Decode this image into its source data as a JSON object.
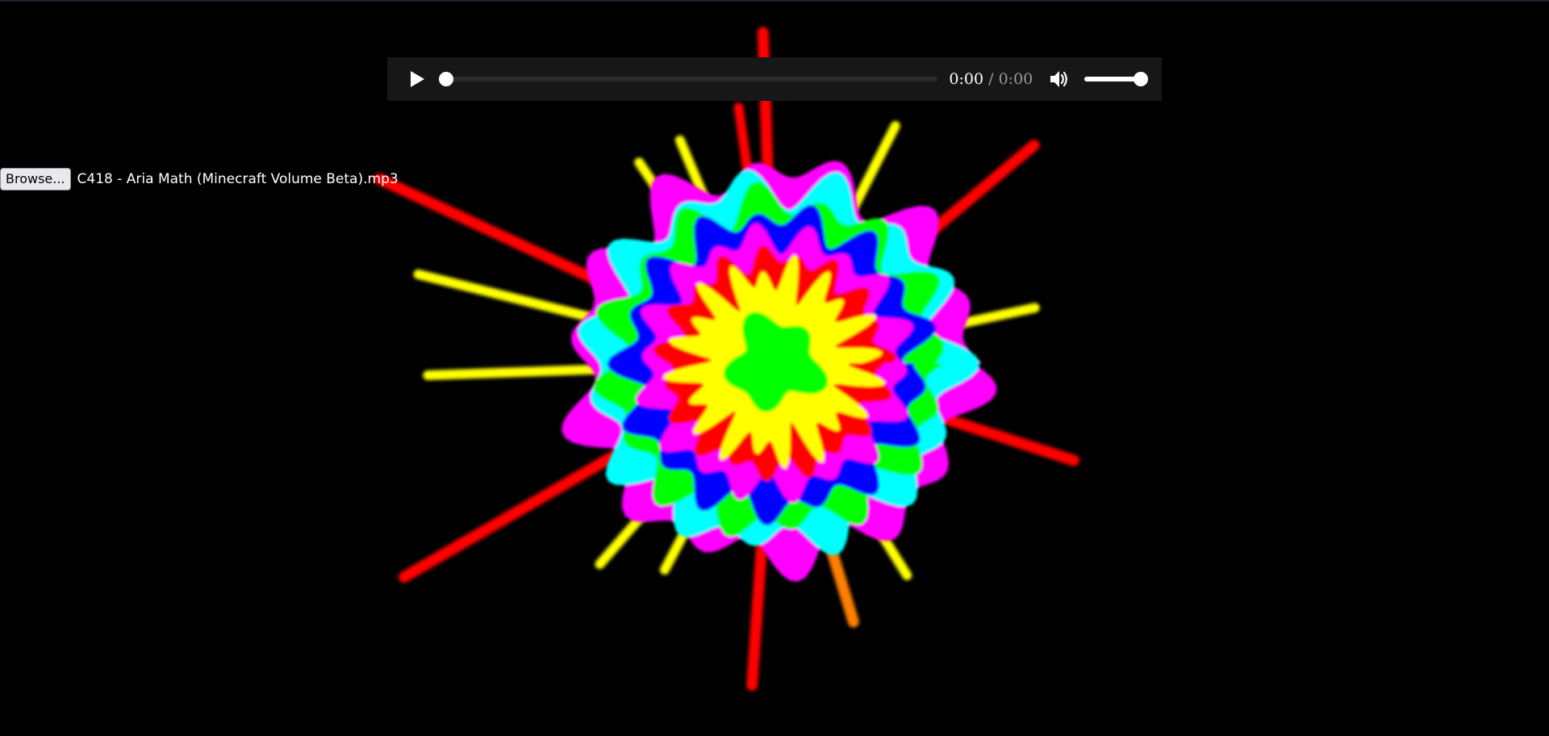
{
  "player": {
    "current_time": "0:00",
    "separator": "/",
    "total_time": "0:00",
    "progress": 0.0,
    "volume": 1.0,
    "play_icon": "play-icon",
    "volume_icon": "speaker-icon"
  },
  "file_input": {
    "button_label": "Browse...",
    "file_name": "C418 - Aria Math (Minecraft Volume Beta).mp3"
  },
  "visualizer": {
    "colors": {
      "red": "#ff0000",
      "yellow": "#ffff00",
      "green": "#00ff00",
      "blue": "#0000ff",
      "magenta": "#ff00ff",
      "cyan": "#00ffff",
      "orange": "#ff7f00",
      "background": "#000000"
    }
  }
}
